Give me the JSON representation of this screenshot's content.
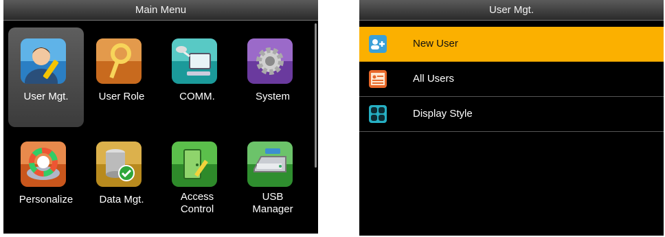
{
  "main_menu": {
    "title": "Main Menu",
    "tiles": [
      {
        "label": "User Mgt.",
        "icon": "user-mgt-icon",
        "selected": true
      },
      {
        "label": "User Role",
        "icon": "key-icon"
      },
      {
        "label": "COMM.",
        "icon": "network-icon"
      },
      {
        "label": "System",
        "icon": "gear-icon"
      },
      {
        "label": "Personalize",
        "icon": "color-wheel-icon"
      },
      {
        "label": "Data Mgt.",
        "icon": "database-icon"
      },
      {
        "label": "Access Control",
        "label_line1": "Access",
        "label_line2": "Control",
        "icon": "door-icon"
      },
      {
        "label": "USB Manager",
        "label_line1": "USB",
        "label_line2": "Manager",
        "icon": "usb-drive-icon"
      }
    ]
  },
  "user_mgt": {
    "title": "User Mgt.",
    "items": [
      {
        "label": "New User",
        "icon": "add-user-icon",
        "selected": true
      },
      {
        "label": "All Users",
        "icon": "user-list-icon"
      },
      {
        "label": "Display Style",
        "icon": "grid-style-icon"
      }
    ]
  },
  "colors": {
    "highlight": "#fbb000",
    "background": "#000000"
  }
}
